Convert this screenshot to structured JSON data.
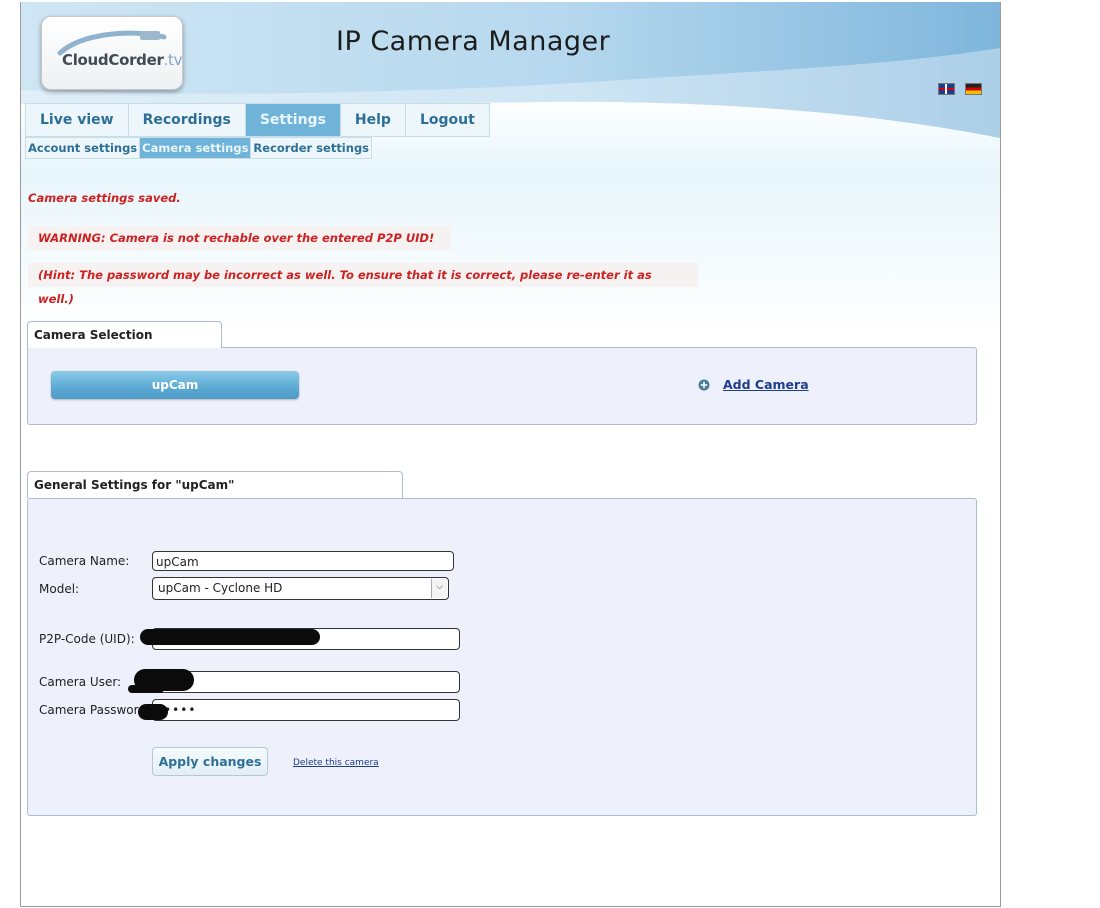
{
  "app": {
    "logo_text": "CloudCorder",
    "logo_tld": ".tv",
    "title": "IP Camera Manager"
  },
  "languages": [
    "en",
    "de"
  ],
  "nav": {
    "tabs": [
      "Live view",
      "Recordings",
      "Settings",
      "Help",
      "Logout"
    ],
    "active_tab": "Settings",
    "subtabs": [
      "Account settings",
      "Camera settings",
      "Recorder settings"
    ],
    "active_subtab": "Camera settings"
  },
  "messages": {
    "saved": "Camera settings saved.",
    "warning": "WARNING: Camera is not rechable over the entered P2P UID!",
    "hint": "(Hint: The password may be incorrect as well. To ensure that it is correct, please re-enter it as well.)"
  },
  "camera_selection": {
    "heading": "Camera Selection",
    "cameras": [
      "upCam"
    ],
    "add_label": "Add Camera"
  },
  "general": {
    "heading": "General Settings for \"upCam\"",
    "name_label": "Camera Name:",
    "name_value": "upCam",
    "model_label": "Model:",
    "model_value": "upCam - Cyclone HD",
    "uid_label": "P2P-Code (UID):",
    "user_label": "Camera User:",
    "password_label": "Camera Password:",
    "password_mask": "•••••",
    "apply_label": "Apply changes",
    "delete_label": "Delete this camera"
  },
  "colors": {
    "accent": "#6fb3d8",
    "link": "#1e3d8a",
    "error": "#cc2222",
    "panel": "#eef0fb"
  }
}
